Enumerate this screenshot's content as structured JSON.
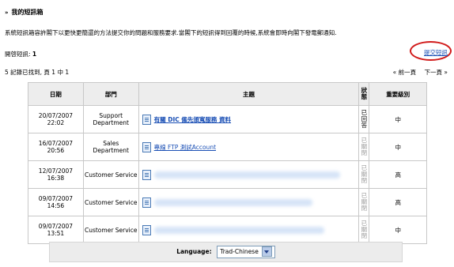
{
  "header": {
    "bullets": "»",
    "title": "我的短訊箱"
  },
  "intro": "系統短訊箱容許閣下以更快更簡還的方法提交你的問題和服務要求.當閣下的短訊得到回覆的時候,系統會即時向閣下發電郵通知.",
  "open_count": {
    "label": "開啓短訊:",
    "value": "1"
  },
  "new_ticket_link": "提交短訊",
  "records": "5 記錄已找到, 頁 1 中 1",
  "pager": {
    "prev": "« 前一頁",
    "next": "下一頁 »"
  },
  "table": {
    "columns": [
      "日期",
      "部門",
      "主題",
      "狀態",
      "重要級別"
    ],
    "rows": [
      {
        "date": "20/07/2007 22:02",
        "dept": "Support Department",
        "subject": "有關 DIC 僱先頒寬服務 資料",
        "status": "已回答",
        "priority": "中"
      },
      {
        "date": "16/07/2007 20:56",
        "dept": "Sales Department",
        "subject": "專線 FTP 測試Account",
        "status": "已關閉",
        "priority": "中"
      },
      {
        "date": "12/07/2007 16:38",
        "dept": "Customer Service",
        "subject": "",
        "status": "已關閉",
        "priority": "高"
      },
      {
        "date": "09/07/2007 14:56",
        "dept": "Customer Service",
        "subject": "",
        "status": "已關閉",
        "priority": "高"
      },
      {
        "date": "09/07/2007 13:51",
        "dept": "Customer Service",
        "subject": "",
        "status": "已關閉",
        "priority": "中"
      }
    ]
  },
  "language": {
    "label": "Language:",
    "selected": "Trad-Chinese"
  }
}
